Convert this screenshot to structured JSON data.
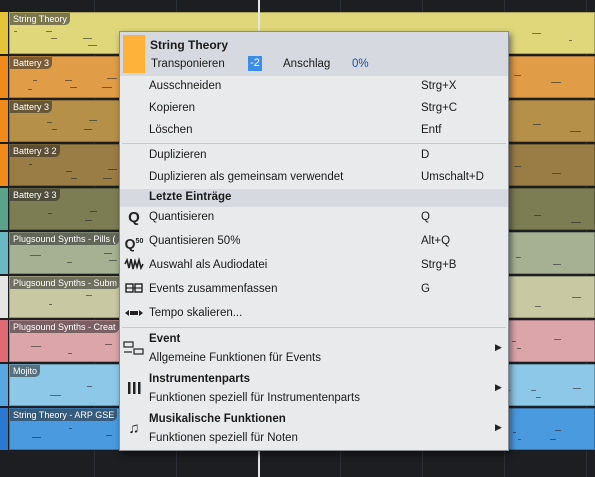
{
  "tracks": [
    {
      "name": "String Theory",
      "color": "#e0d67a",
      "strip": "#e6c43a"
    },
    {
      "name": "Battery 3",
      "color": "#e09c46",
      "strip": "#f08a1a"
    },
    {
      "name": "Battery 3",
      "color": "#b59049",
      "strip": "#f08a1a"
    },
    {
      "name": "Battery 3 2",
      "color": "#9a7c45",
      "strip": "#f08a1a"
    },
    {
      "name": "Battery 3 3",
      "color": "#7c7d52",
      "strip": "#5aa28a"
    },
    {
      "name": "Plugsound Synths - Pills (",
      "color": "#a6b193",
      "strip": "#69b8c4"
    },
    {
      "name": "Plugsound Synths - Subm",
      "color": "#c8c8a2",
      "strip": "#e5e5e5"
    },
    {
      "name": "Plugsound Synths - Creat",
      "color": "#dba5aa",
      "strip": "#e06a74"
    },
    {
      "name": "Mojito",
      "color": "#8ec8e8",
      "strip": "#59a6e0"
    },
    {
      "name": "String Theory - ARP GSE",
      "color": "#4a9ae0",
      "strip": "#2a78d0"
    }
  ],
  "menu": {
    "part_name": "String Theory",
    "part_color": "#ffb23a",
    "transpose_label": "Transponieren",
    "transpose_value": "-2",
    "velocity_label": "Anschlag",
    "velocity_value": "0%",
    "items": [
      {
        "label": "Ausschneiden",
        "shortcut": "Strg+X"
      },
      {
        "label": "Kopieren",
        "shortcut": "Strg+C"
      },
      {
        "label": "Löschen",
        "shortcut": "Entf"
      },
      {
        "label": "Duplizieren",
        "shortcut": "D"
      },
      {
        "label": "Duplizieren als gemeinsam verwendet",
        "shortcut": "Umschalt+D"
      }
    ],
    "recent_header": "Letzte Einträge",
    "recent": [
      {
        "label": "Quantisieren",
        "shortcut": "Q",
        "icon": "quantize-icon"
      },
      {
        "label": "Quantisieren 50%",
        "shortcut": "Alt+Q",
        "icon": "quantize-50-icon"
      },
      {
        "label": "Auswahl als Audiodatei",
        "shortcut": "Strg+B",
        "icon": "waveform-icon"
      },
      {
        "label": "Events zusammenfassen",
        "shortcut": "G",
        "icon": "merge-events-icon"
      },
      {
        "label": "Tempo skalieren...",
        "shortcut": "",
        "icon": "tempo-scale-icon"
      }
    ],
    "submenus": [
      {
        "title": "Event",
        "desc": "Allgemeine Funktionen für Events",
        "icon": "event-icon"
      },
      {
        "title": "Instrumentenparts",
        "desc": "Funktionen speziell für Instrumentenparts",
        "icon": "piano-keys-icon"
      },
      {
        "title": "Musikalische Funktionen",
        "desc": "Funktionen speziell für Noten",
        "icon": "music-note-icon"
      }
    ]
  }
}
